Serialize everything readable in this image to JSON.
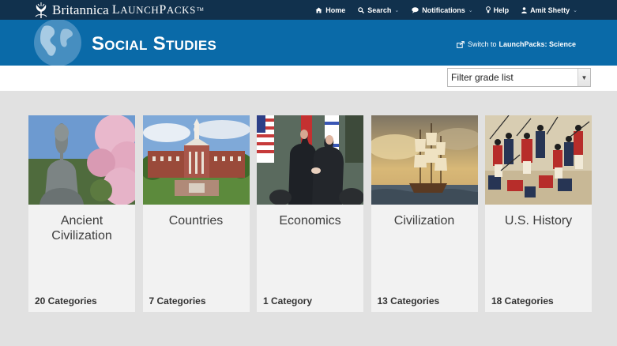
{
  "brand": {
    "name": "Britannica",
    "product_first": "L",
    "product_rest": "AUNCH",
    "product_second": "P",
    "product_end": "ACKS",
    "tm": "TM"
  },
  "nav": {
    "home": "Home",
    "search": "Search",
    "notifications": "Notifications",
    "help": "Help",
    "user": "Amit Shetty"
  },
  "banner": {
    "title": "Social Studies",
    "switch_prefix": "Switch to",
    "switch_target": "LaunchPacks: Science"
  },
  "filter": {
    "selected": "Filter grade list"
  },
  "cards": [
    {
      "title": "Ancient Civilization",
      "count": "20 Categories"
    },
    {
      "title": "Countries",
      "count": "7 Categories"
    },
    {
      "title": "Economics",
      "count": "1 Category"
    },
    {
      "title": "Civilization",
      "count": "13 Categories"
    },
    {
      "title": "U.S. History",
      "count": "18 Categories"
    }
  ],
  "colors": {
    "topnav": "#11314d",
    "banner": "#0a6aa8",
    "page_bg": "#e1e1e1",
    "card_bg": "#f2f2f2"
  }
}
